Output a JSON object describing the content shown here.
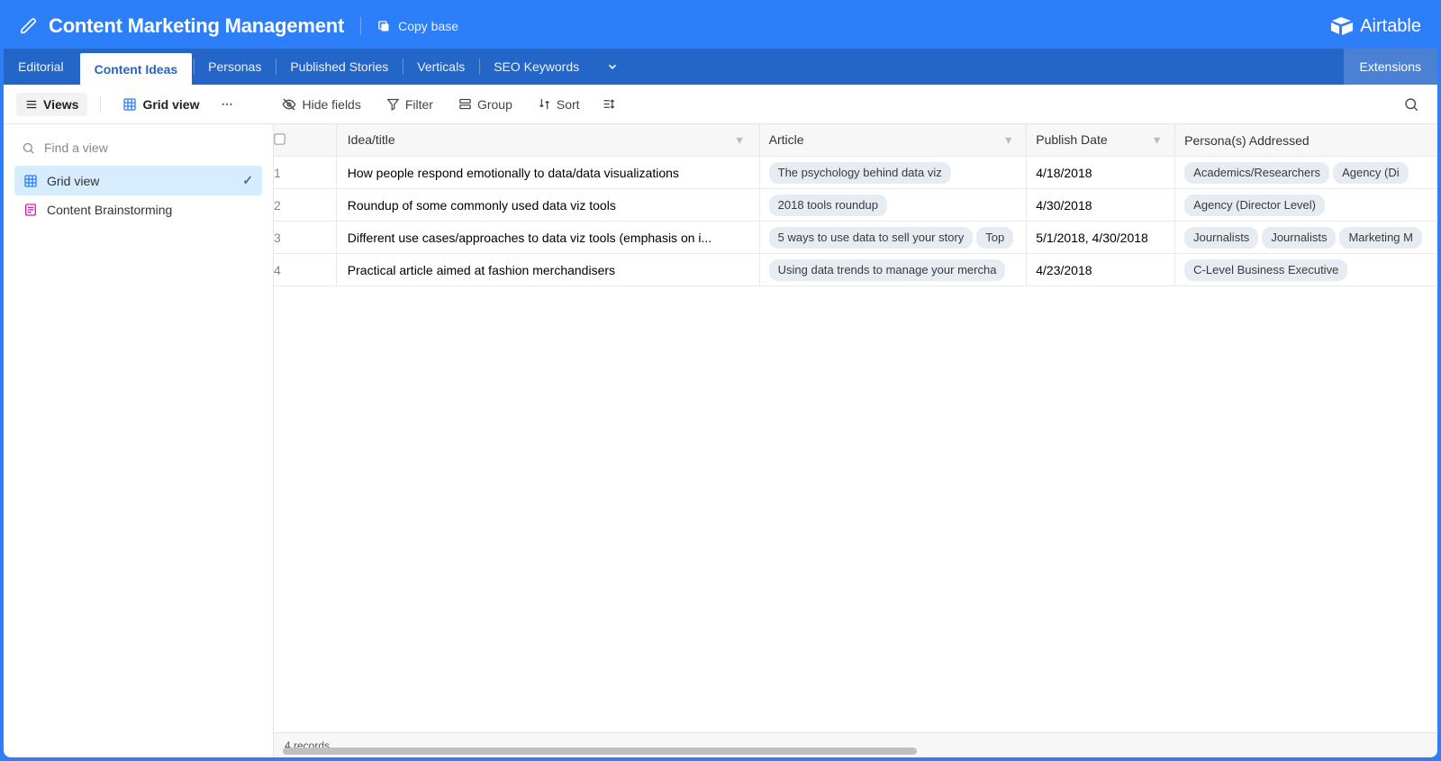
{
  "header": {
    "base_title": "Content Marketing Management",
    "copy_label": "Copy base",
    "brand": "Airtable"
  },
  "tabs": {
    "items": [
      "Editorial",
      "Content Ideas",
      "Personas",
      "Published Stories",
      "Verticals",
      "SEO Keywords"
    ],
    "active_index": 1,
    "extensions_label": "Extensions"
  },
  "toolbar": {
    "views_label": "Views",
    "view_name": "Grid view",
    "hide_fields": "Hide fields",
    "filter": "Filter",
    "group": "Group",
    "sort": "Sort"
  },
  "sidebar": {
    "find_placeholder": "Find a view",
    "views": [
      {
        "label": "Grid view",
        "active": true,
        "icon": "grid"
      },
      {
        "label": "Content Brainstorming",
        "active": false,
        "icon": "form"
      }
    ]
  },
  "grid": {
    "columns": [
      "Idea/title",
      "Article",
      "Publish Date",
      "Persona(s) Addressed"
    ],
    "rows": [
      {
        "num": "1",
        "title": "How people respond emotionally to data/data visualizations",
        "articles": [
          "The psychology behind data viz"
        ],
        "date": "4/18/2018",
        "personas": [
          "Academics/Researchers",
          "Agency (Di"
        ]
      },
      {
        "num": "2",
        "title": "Roundup of some commonly used data viz tools",
        "articles": [
          "2018 tools roundup"
        ],
        "date": "4/30/2018",
        "personas": [
          "Agency (Director Level)"
        ]
      },
      {
        "num": "3",
        "title": "Different use cases/approaches to data viz tools (emphasis on i...",
        "articles": [
          "5 ways to use data to sell your story",
          "Top"
        ],
        "date": "5/1/2018, 4/30/2018",
        "personas": [
          "Journalists",
          "Journalists",
          "Marketing M"
        ]
      },
      {
        "num": "4",
        "title": "Practical article aimed at fashion merchandisers",
        "articles": [
          "Using data trends to manage your mercha"
        ],
        "date": "4/23/2018",
        "personas": [
          "C-Level Business Executive"
        ]
      }
    ],
    "record_count_label": "4 records"
  }
}
